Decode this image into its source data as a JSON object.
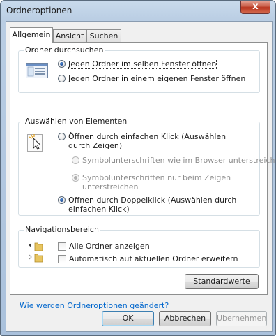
{
  "window": {
    "title": "Ordneroptionen",
    "close_glyph": "x"
  },
  "tabs": [
    {
      "label": "Allgemein",
      "active": true
    },
    {
      "label": "Ansicht",
      "active": false
    },
    {
      "label": "Suchen",
      "active": false
    }
  ],
  "browse_folders": {
    "title": "Ordner durchsuchen",
    "options": [
      {
        "label": "Jeden Ordner im selben Fenster öffnen",
        "checked": true
      },
      {
        "label": "Jeden Ordner in einem eigenen Fenster öffnen",
        "checked": false
      }
    ]
  },
  "click_items": {
    "title": "Auswählen von Elementen",
    "single_click": {
      "label": "Öffnen durch einfachen Klick (Auswählen durch Zeigen)",
      "checked": false
    },
    "underline_browser": {
      "label": "Symbolunterschriften wie im Browser unterstreichen",
      "checked": false,
      "enabled": false
    },
    "underline_point": {
      "label": "Symbolunterschriften nur beim Zeigen unterstreichen",
      "checked": true,
      "enabled": false
    },
    "double_click": {
      "label": "Öffnen durch Doppelklick (Auswählen durch einfachen Klick)",
      "checked": true
    }
  },
  "nav_pane": {
    "title": "Navigationsbereich",
    "show_all": {
      "label": "Alle Ordner anzeigen",
      "checked": false
    },
    "auto_expand": {
      "label": "Automatisch auf aktuellen Ordner erweitern",
      "checked": false
    }
  },
  "restore_defaults": "Standardwerte",
  "help_link": "Wie werden Ordneroptionen geändert?",
  "buttons": {
    "ok": "OK",
    "cancel": "Abbrechen",
    "apply": "Übernehmen"
  },
  "icons": {
    "close": "close-icon",
    "window_layout": "window-layout-icon",
    "click_cursor": "cursor-click-icon",
    "folder": "folder-icon"
  }
}
